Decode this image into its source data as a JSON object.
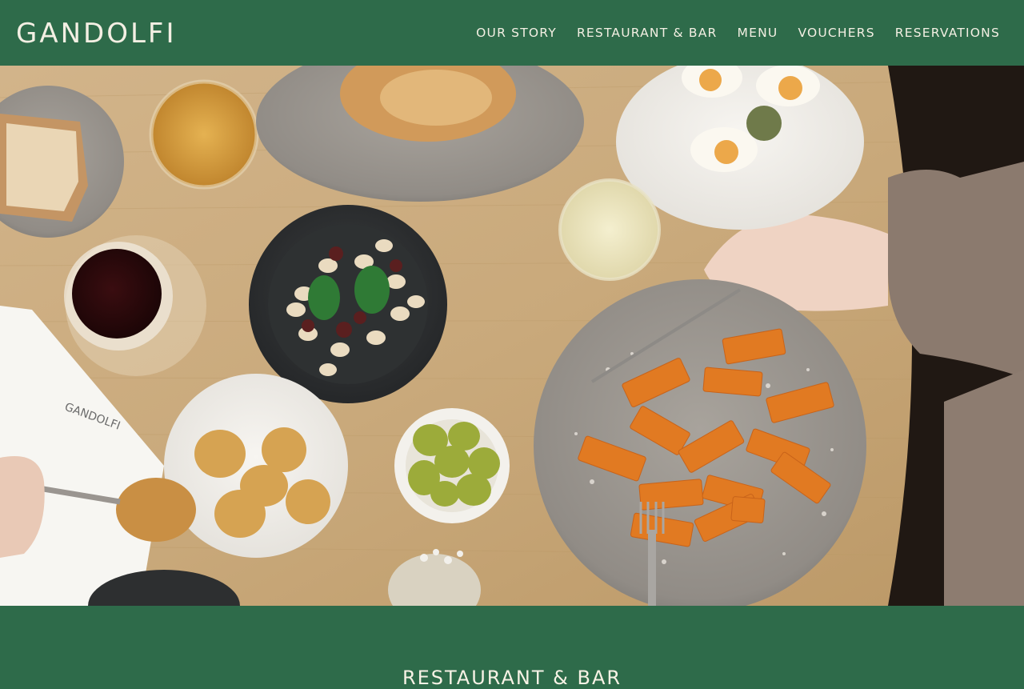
{
  "brand": {
    "logo_text": "GANDOLFI"
  },
  "nav": {
    "items": [
      {
        "label": "OUR STORY"
      },
      {
        "label": "RESTAURANT & BAR"
      },
      {
        "label": "MENU"
      },
      {
        "label": "VOUCHERS"
      },
      {
        "label": "RESERVATIONS"
      }
    ]
  },
  "hero": {
    "alt": "Overhead view of a restaurant table with pasta, gnocchi, olives, potatoes, eggs and drinks"
  },
  "section": {
    "title": "RESTAURANT & BAR"
  },
  "colors": {
    "brand_green": "#2e6b4a",
    "cream_text": "#f3efe3"
  }
}
